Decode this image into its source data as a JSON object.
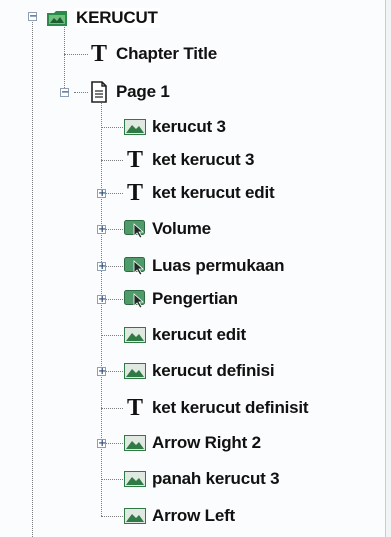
{
  "tree": {
    "root": {
      "label": "KERUCUT",
      "icon": "book-folder-icon",
      "expanded": true
    },
    "children": [
      {
        "label": "Chapter Title",
        "icon": "text-t-icon"
      },
      {
        "label": "Page 1",
        "icon": "page-icon",
        "expanded": true,
        "children": [
          {
            "label": "kerucut 3",
            "icon": "image-icon",
            "expandable": false
          },
          {
            "label": "ket kerucut 3",
            "icon": "text-t-icon",
            "expandable": false
          },
          {
            "label": "ket kerucut edit",
            "icon": "text-t-icon",
            "expandable": true
          },
          {
            "label": "Volume",
            "icon": "button-cursor-icon",
            "expandable": true
          },
          {
            "label": "Luas permukaan",
            "icon": "button-cursor-icon",
            "expandable": true
          },
          {
            "label": "Pengertian",
            "icon": "button-cursor-icon",
            "expandable": true
          },
          {
            "label": "kerucut edit",
            "icon": "image-icon",
            "expandable": false
          },
          {
            "label": "kerucut definisi",
            "icon": "image-icon",
            "expandable": true
          },
          {
            "label": "ket kerucut definisit",
            "icon": "text-t-icon",
            "expandable": false
          },
          {
            "label": "Arrow Right 2",
            "icon": "image-icon",
            "expandable": true
          },
          {
            "label": "panah kerucut 3",
            "icon": "image-icon",
            "expandable": false
          },
          {
            "label": "Arrow Left",
            "icon": "image-icon",
            "expandable": false
          }
        ]
      }
    ]
  },
  "colors": {
    "image_icon": "#2f7a45",
    "folder_icon": "#2a8a4a",
    "cursor_icon": "#3a7f55",
    "dotted_line": "#7d7d7d"
  }
}
